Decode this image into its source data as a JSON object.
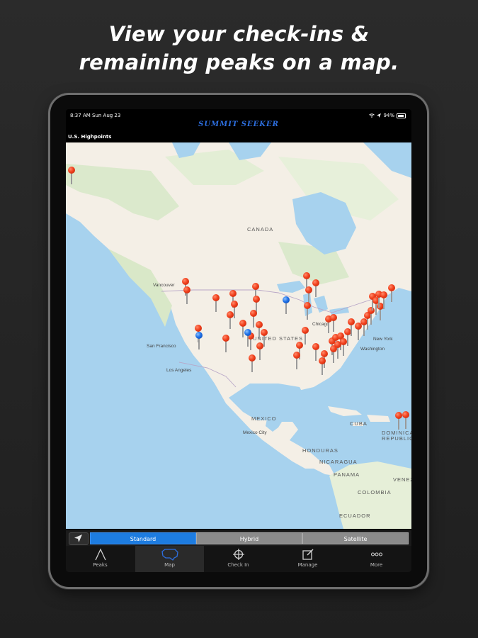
{
  "headline": {
    "line1": "View your check-ins &",
    "line2": "remaining peaks on a map."
  },
  "statusbar": {
    "time": "8:37 AM  Sun Aug 23",
    "battery": "94%",
    "icons": [
      "wifi-icon",
      "location-arrow-icon",
      "battery-icon"
    ]
  },
  "app": {
    "title": "SUMMIT SEEKER",
    "page_title": "U.S. Highpoints"
  },
  "map": {
    "labels": {
      "canada": "CANADA",
      "united_states": "UNITED STATES",
      "mexico": "MEXICO",
      "cuba": "CUBA",
      "dominican_republic_1": "DOMINICAN",
      "dominican_republic_2": "REPUBLIC",
      "honduras": "HONDURAS",
      "nicaragua": "NICARAGUA",
      "panama": "PANAMA",
      "colombia": "COLOMBIA",
      "ecuador": "ECUADOR",
      "venezuela": "VENEZ"
    },
    "cities": {
      "vancouver": "Vancouver",
      "san_francisco": "San Francisco",
      "los_angeles": "Los Angeles",
      "chicago": "Chicago",
      "new_york": "New York",
      "washington": "Washington",
      "mexico_city": "Mexico City"
    },
    "pin_colors": {
      "unclimbed": "#f1401d",
      "checked_in": "#1e6fe6"
    }
  },
  "map_type": {
    "options": [
      "Standard",
      "Hybrid",
      "Satellite"
    ],
    "selected": "Standard",
    "locate_icon": "location-arrow-icon"
  },
  "tabs": [
    {
      "label": "Peaks",
      "icon": "peak-icon",
      "active": false
    },
    {
      "label": "Map",
      "icon": "map-icon",
      "active": true
    },
    {
      "label": "Check In",
      "icon": "crosshair-icon",
      "active": false
    },
    {
      "label": "Manage",
      "icon": "edit-icon",
      "active": false
    },
    {
      "label": "More",
      "icon": "more-icon",
      "active": false
    }
  ]
}
